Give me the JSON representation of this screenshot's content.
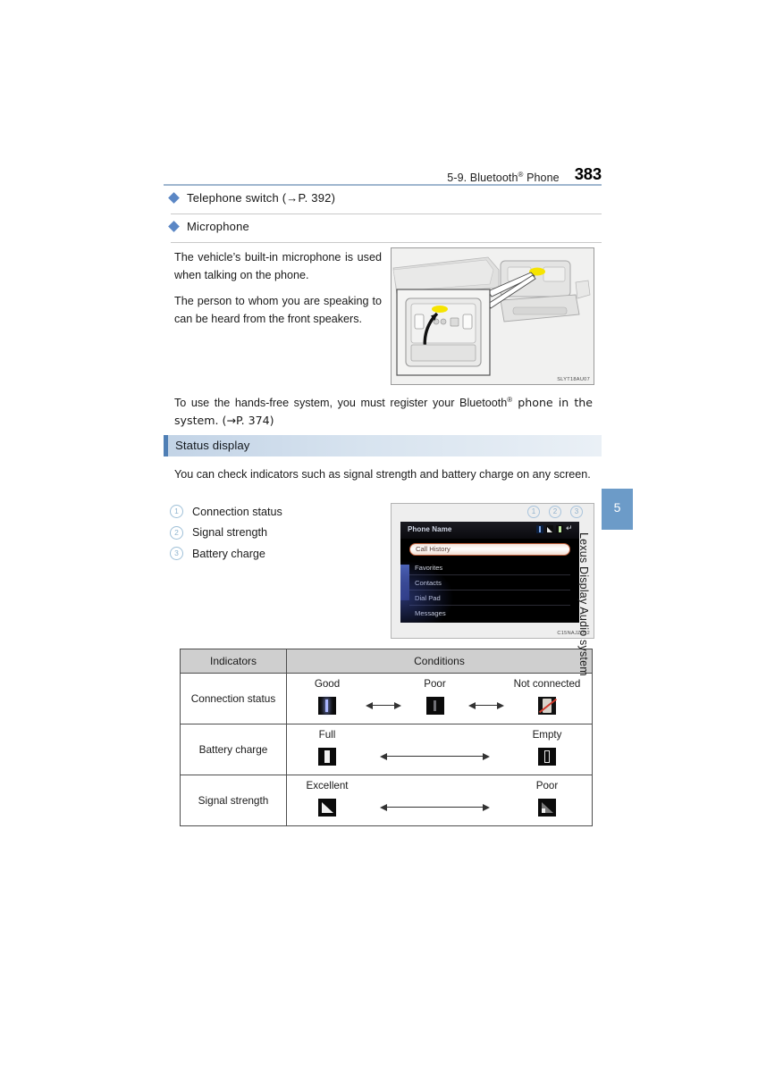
{
  "header": {
    "section": "5-9. Bluetooth",
    "section_sup": "®",
    "section_tail": " Phone",
    "page_number": "383"
  },
  "sections": [
    {
      "label": "Telephone switch (→P. 392)"
    },
    {
      "label": "Microphone"
    }
  ],
  "microphone": {
    "paragraph_1": "The vehicle’s built-in microphone is used when talking on the phone.",
    "paragraph_2": "The person to whom you are speaking to can be heard from the front speakers.",
    "figure_caption": "SLYT18AU07"
  },
  "handsfree_note": {
    "text_before": "To use the hands-free system, you must register your Bluetooth",
    "sup": "®",
    "text_after": " phone in the system. (→P. 374)"
  },
  "status_display": {
    "banner_label": "Status display",
    "intro": "You can check indicators such as signal strength and battery charge on any screen.",
    "legend": [
      {
        "num": "1",
        "label": "Connection status"
      },
      {
        "num": "2",
        "label": "Signal strength"
      },
      {
        "num": "3",
        "label": "Battery charge"
      }
    ],
    "screen": {
      "title": "Phone Name",
      "menu": [
        "Call History",
        "Favorites",
        "Contacts",
        "Dial Pad",
        "Messages"
      ],
      "status_icons": [
        "bluetooth-icon",
        "signal-icon",
        "battery-icon",
        "back-icon"
      ],
      "callouts": [
        "1",
        "2",
        "3"
      ],
      "figure_caption": "C15NAJZ052"
    }
  },
  "table": {
    "headers": {
      "indicators": "Indicators",
      "conditions": "Conditions"
    },
    "rows": [
      {
        "indicator": "Connection status",
        "states": [
          "Good",
          "Poor",
          "Not connected"
        ],
        "icons": [
          "bluetooth-good-icon",
          "bluetooth-poor-icon",
          "bluetooth-disconnected-icon"
        ]
      },
      {
        "indicator": "Battery charge",
        "states": [
          "Full",
          "Empty"
        ],
        "icons": [
          "battery-full-icon",
          "battery-empty-icon"
        ]
      },
      {
        "indicator": "Signal strength",
        "states": [
          "Excellent",
          "Poor"
        ],
        "icons": [
          "signal-excellent-icon",
          "signal-poor-icon"
        ]
      }
    ]
  },
  "side_tab": {
    "chapter_number": "5",
    "chapter_title": "Lexus Display Audio system"
  },
  "colors": {
    "accent_blue": "#5b87c5",
    "tab_blue": "#6c9bc8",
    "banner_bar": "#4f7fb5",
    "rule": "#9fb6cf"
  }
}
